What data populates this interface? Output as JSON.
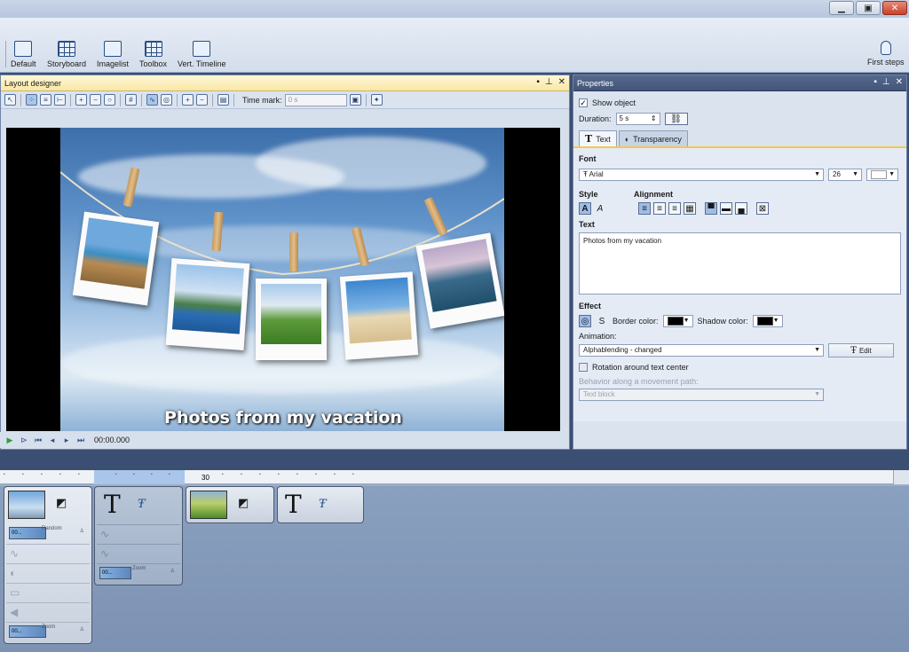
{
  "window": {
    "minimize_symbol": "▁",
    "maximize_symbol": "▣",
    "close_symbol": "✕"
  },
  "toolbar": {
    "items": [
      {
        "label": "Default",
        "icon": "layout-default-icon"
      },
      {
        "label": "Storyboard",
        "icon": "storyboard-icon"
      },
      {
        "label": "Imagelist",
        "icon": "imagelist-icon"
      },
      {
        "label": "Toolbox",
        "icon": "toolbox-icon"
      },
      {
        "label": "Vert. Timeline",
        "icon": "vertical-timeline-icon"
      }
    ],
    "first_steps": "First steps"
  },
  "layout_designer": {
    "title": "Layout designer",
    "time_mark_label": "Time mark:",
    "time_mark_value": "0 s",
    "stage_caption": "Photos from my vacation",
    "timecode": "00:00.000"
  },
  "properties": {
    "title": "Properties",
    "show_object": "Show object",
    "show_object_checked": true,
    "duration_label": "Duration:",
    "duration_value": "5 s",
    "tabs": [
      {
        "label": "Text",
        "active": true
      },
      {
        "label": "Transparency",
        "active": false
      }
    ],
    "font_section": "Font",
    "font_name": "Arial",
    "font_size": "26",
    "font_color": "#ffffff",
    "style_section": "Style",
    "alignment_section": "Alignment",
    "text_section": "Text",
    "text_value": "Photos from my vacation",
    "effect_section": "Effect",
    "border_color_label": "Border color:",
    "border_color": "#000000",
    "shadow_color_label": "Shadow color:",
    "shadow_color": "#000000",
    "animation_label": "Animation:",
    "animation_value": "Alphablending - changed",
    "edit_button": "Edit",
    "rotation_label": "Rotation around text center",
    "movement_path_label": "Behavior along a movement path:",
    "movement_path_value": "Text block"
  },
  "timeline": {
    "ruler_big_label": "30",
    "clip1": {
      "anim_label": "Random",
      "bar_text": "00...",
      "zoom_label": "Zoom",
      "zoom_bar_text": "00..."
    },
    "clip2": {
      "zoom_label": "Zoom",
      "bar_text": "00..."
    }
  }
}
